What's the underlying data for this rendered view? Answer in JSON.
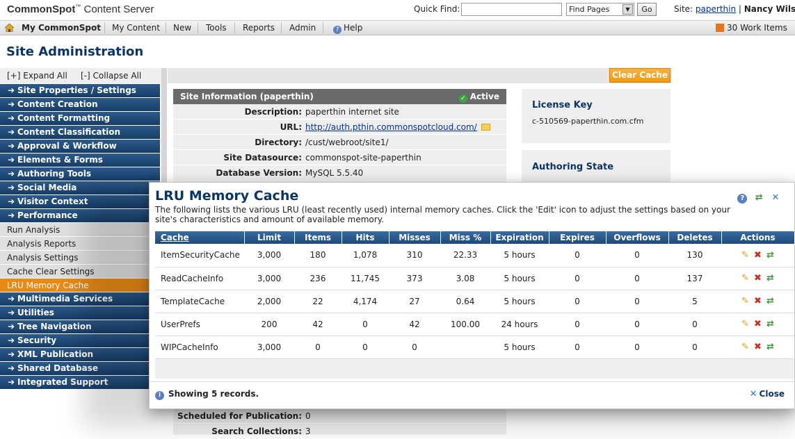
{
  "header": {
    "brand": "CommonSpot",
    "brand_suffix": "Content Server",
    "quick_find_label": "Quick Find:",
    "quick_find_value": "",
    "find_select": "Find Pages",
    "go_label": "Go",
    "site_label": "Site:",
    "site_name": "paperthin",
    "user_name": "Nancy Wilso"
  },
  "menu": {
    "my_commonspot": "My CommonSpot",
    "my_content": "My Content",
    "new": "New",
    "tools": "Tools",
    "reports": "Reports",
    "admin": "Admin",
    "help": "Help",
    "work_items": "30 Work Items"
  },
  "page_title": "Site Administration",
  "sidebar": {
    "expand_all": "[+] Expand All",
    "collapse_all": "[-] Collapse All",
    "sections": [
      "Site Properties / Settings",
      "Content Creation",
      "Content Formatting",
      "Content Classification",
      "Approval & Workflow",
      "Elements & Forms",
      "Authoring Tools",
      "Social Media",
      "Visitor Context",
      "Performance"
    ],
    "performance_items": [
      "Run Analysis",
      "Analysis Reports",
      "Analysis Settings",
      "Cache Clear Settings",
      "LRU Memory Cache"
    ],
    "sections_after": [
      "Multimedia Services",
      "Utilities",
      "Tree Navigation",
      "Security",
      "XML Publication",
      "Shared Database",
      "Integrated Support"
    ]
  },
  "background": {
    "clear_cache": "Clear Cache",
    "site_info_title": "Site Information (paperthin)",
    "site_status": "Active",
    "rows": [
      {
        "label": "Description:",
        "value": "paperthin internet site"
      },
      {
        "label": "URL:",
        "value": "http://auth.pthin.commonspotcloud.com/"
      },
      {
        "label": "Directory:",
        "value": "/cust/webroot/site1/"
      },
      {
        "label": "Site Datasource:",
        "value": "commonspot-site-paperthin"
      },
      {
        "label": "Database Version:",
        "value": "MySQL 5.5.40"
      }
    ],
    "bottom_rows": [
      {
        "label": "Scheduled for Publication:",
        "value": "0"
      },
      {
        "label": "Search Collections:",
        "value": "3"
      }
    ],
    "license_key_title": "License Key",
    "license_key_value": "c-510569-paperthin.com.cfm",
    "authoring_state_title": "Authoring State"
  },
  "modal": {
    "title": "LRU Memory Cache",
    "description": "The following lists the various LRU (least recently used) internal memory caches. Click the 'Edit' icon to adjust the settings based on your site's characteristics and amount of available memory.",
    "columns": [
      "Cache",
      "Limit",
      "Items",
      "Hits",
      "Misses",
      "Miss %",
      "Expiration",
      "Expires",
      "Overflows",
      "Deletes",
      "Actions"
    ],
    "rows": [
      [
        "ItemSecurityCache",
        "3,000",
        "180",
        "1,078",
        "310",
        "22.33",
        "5 hours",
        "0",
        "0",
        "130"
      ],
      [
        "ReadCacheInfo",
        "3,000",
        "236",
        "11,745",
        "373",
        "3.08",
        "5 hours",
        "0",
        "0",
        "137"
      ],
      [
        "TemplateCache",
        "2,000",
        "22",
        "4,174",
        "27",
        "0.64",
        "5 hours",
        "0",
        "0",
        "5"
      ],
      [
        "UserPrefs",
        "200",
        "42",
        "0",
        "42",
        "100.00",
        "24 hours",
        "0",
        "0",
        "0"
      ],
      [
        "WIPCacheInfo",
        "3,000",
        "0",
        "0",
        "0",
        "",
        "5 hours",
        "0",
        "0",
        "0"
      ]
    ],
    "records": "Showing 5 records.",
    "close": "Close"
  }
}
